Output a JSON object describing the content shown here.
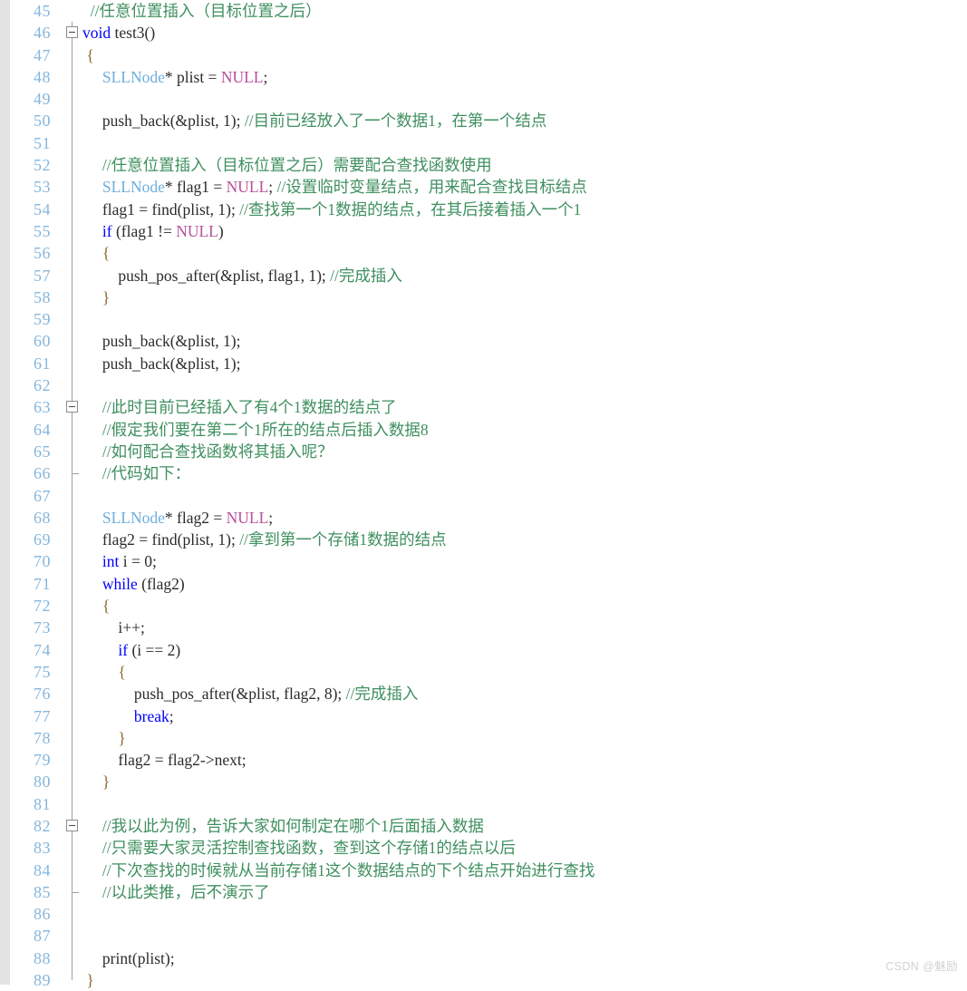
{
  "editor": {
    "language": "c",
    "first_line_number": 45,
    "colors": {
      "background": "#ffffff",
      "gutter_strip": "#e3e3e5",
      "line_number": "#85b6dd",
      "comment": "#3f8f5f",
      "keyword": "#0000ff",
      "type": "#6faedc",
      "macro": "#b7509a",
      "brace": "#8a6a2a",
      "text": "#2b2b2b",
      "fold_line": "#a0a0a0"
    }
  },
  "watermark": "CSDN @魅励",
  "lines": [
    {
      "n": "45",
      "fold": "none",
      "tokens": [
        {
          "t": "  ",
          "c": "plain"
        },
        {
          "t": "//任意位置插入（目标位置之后）",
          "c": "cmt"
        }
      ]
    },
    {
      "n": "46",
      "fold": "box",
      "tokens": [
        {
          "t": "void",
          "c": "kw"
        },
        {
          "t": " test3()",
          "c": "plain"
        }
      ]
    },
    {
      "n": "47",
      "fold": "line",
      "tokens": [
        {
          "t": " ",
          "c": "plain"
        },
        {
          "t": "{",
          "c": "brace"
        }
      ]
    },
    {
      "n": "48",
      "fold": "line",
      "tokens": [
        {
          "t": "     ",
          "c": "plain"
        },
        {
          "t": "SLLNode",
          "c": "type"
        },
        {
          "t": "* plist = ",
          "c": "plain"
        },
        {
          "t": "NULL",
          "c": "macro"
        },
        {
          "t": ";",
          "c": "plain"
        }
      ]
    },
    {
      "n": "49",
      "fold": "line",
      "tokens": []
    },
    {
      "n": "50",
      "fold": "line",
      "tokens": [
        {
          "t": "     push_back(&plist, 1); ",
          "c": "plain"
        },
        {
          "t": "//目前已经放入了一个数据1，在第一个结点",
          "c": "cmt"
        }
      ]
    },
    {
      "n": "51",
      "fold": "line",
      "tokens": []
    },
    {
      "n": "52",
      "fold": "line",
      "tokens": [
        {
          "t": "     ",
          "c": "plain"
        },
        {
          "t": "//任意位置插入（目标位置之后）需要配合查找函数使用",
          "c": "cmt"
        }
      ]
    },
    {
      "n": "53",
      "fold": "line",
      "tokens": [
        {
          "t": "     ",
          "c": "plain"
        },
        {
          "t": "SLLNode",
          "c": "type"
        },
        {
          "t": "* flag1 = ",
          "c": "plain"
        },
        {
          "t": "NULL",
          "c": "macro"
        },
        {
          "t": "; ",
          "c": "plain"
        },
        {
          "t": "//设置临时变量结点，用来配合查找目标结点",
          "c": "cmt"
        }
      ]
    },
    {
      "n": "54",
      "fold": "line",
      "tokens": [
        {
          "t": "     flag1 = find(plist, 1); ",
          "c": "plain"
        },
        {
          "t": "//查找第一个1数据的结点，在其后接着插入一个1",
          "c": "cmt"
        }
      ]
    },
    {
      "n": "55",
      "fold": "line",
      "tokens": [
        {
          "t": "     ",
          "c": "plain"
        },
        {
          "t": "if",
          "c": "kw"
        },
        {
          "t": " (flag1 != ",
          "c": "plain"
        },
        {
          "t": "NULL",
          "c": "macro"
        },
        {
          "t": ")",
          "c": "plain"
        }
      ]
    },
    {
      "n": "56",
      "fold": "line",
      "tokens": [
        {
          "t": "     ",
          "c": "plain"
        },
        {
          "t": "{",
          "c": "brace"
        }
      ]
    },
    {
      "n": "57",
      "fold": "line",
      "tokens": [
        {
          "t": "         push_pos_after(&plist, flag1, 1); ",
          "c": "plain"
        },
        {
          "t": "//完成插入",
          "c": "cmt"
        }
      ]
    },
    {
      "n": "58",
      "fold": "line",
      "tokens": [
        {
          "t": "     ",
          "c": "plain"
        },
        {
          "t": "}",
          "c": "brace"
        }
      ]
    },
    {
      "n": "59",
      "fold": "line",
      "tokens": []
    },
    {
      "n": "60",
      "fold": "line",
      "tokens": [
        {
          "t": "     push_back(&plist, 1);",
          "c": "plain"
        }
      ]
    },
    {
      "n": "61",
      "fold": "line",
      "tokens": [
        {
          "t": "     push_back(&plist, 1);",
          "c": "plain"
        }
      ]
    },
    {
      "n": "62",
      "fold": "line",
      "tokens": []
    },
    {
      "n": "63",
      "fold": "box",
      "tokens": [
        {
          "t": "     ",
          "c": "plain"
        },
        {
          "t": "//此时目前已经插入了有4个1数据的结点了",
          "c": "cmt"
        }
      ]
    },
    {
      "n": "64",
      "fold": "line",
      "tokens": [
        {
          "t": "     ",
          "c": "plain"
        },
        {
          "t": "//假定我们要在第二个1所在的结点后插入数据8",
          "c": "cmt"
        }
      ]
    },
    {
      "n": "65",
      "fold": "line",
      "tokens": [
        {
          "t": "     ",
          "c": "plain"
        },
        {
          "t": "//如何配合查找函数将其插入呢？",
          "c": "cmt"
        }
      ]
    },
    {
      "n": "66",
      "fold": "tick",
      "tokens": [
        {
          "t": "     ",
          "c": "plain"
        },
        {
          "t": "//代码如下：",
          "c": "cmt"
        }
      ]
    },
    {
      "n": "67",
      "fold": "line",
      "tokens": []
    },
    {
      "n": "68",
      "fold": "line",
      "tokens": [
        {
          "t": "     ",
          "c": "plain"
        },
        {
          "t": "SLLNode",
          "c": "type"
        },
        {
          "t": "* flag2 = ",
          "c": "plain"
        },
        {
          "t": "NULL",
          "c": "macro"
        },
        {
          "t": ";",
          "c": "plain"
        }
      ]
    },
    {
      "n": "69",
      "fold": "line",
      "tokens": [
        {
          "t": "     flag2 = find(plist, 1); ",
          "c": "plain"
        },
        {
          "t": "//拿到第一个存储1数据的结点",
          "c": "cmt"
        }
      ]
    },
    {
      "n": "70",
      "fold": "line",
      "tokens": [
        {
          "t": "     ",
          "c": "plain"
        },
        {
          "t": "int",
          "c": "kw"
        },
        {
          "t": " i = 0;",
          "c": "plain"
        }
      ]
    },
    {
      "n": "71",
      "fold": "line",
      "tokens": [
        {
          "t": "     ",
          "c": "plain"
        },
        {
          "t": "while",
          "c": "kw"
        },
        {
          "t": " (flag2)",
          "c": "plain"
        }
      ]
    },
    {
      "n": "72",
      "fold": "line",
      "tokens": [
        {
          "t": "     ",
          "c": "plain"
        },
        {
          "t": "{",
          "c": "brace"
        }
      ]
    },
    {
      "n": "73",
      "fold": "line",
      "tokens": [
        {
          "t": "         i++;",
          "c": "plain"
        }
      ]
    },
    {
      "n": "74",
      "fold": "line",
      "tokens": [
        {
          "t": "         ",
          "c": "plain"
        },
        {
          "t": "if",
          "c": "kw"
        },
        {
          "t": " (i == 2)",
          "c": "plain"
        }
      ]
    },
    {
      "n": "75",
      "fold": "line",
      "tokens": [
        {
          "t": "         ",
          "c": "plain"
        },
        {
          "t": "{",
          "c": "brace"
        }
      ]
    },
    {
      "n": "76",
      "fold": "line",
      "tokens": [
        {
          "t": "             push_pos_after(&plist, flag2, 8); ",
          "c": "plain"
        },
        {
          "t": "//完成插入",
          "c": "cmt"
        }
      ]
    },
    {
      "n": "77",
      "fold": "line",
      "tokens": [
        {
          "t": "             ",
          "c": "plain"
        },
        {
          "t": "break",
          "c": "kw"
        },
        {
          "t": ";",
          "c": "plain"
        }
      ]
    },
    {
      "n": "78",
      "fold": "line",
      "tokens": [
        {
          "t": "         ",
          "c": "plain"
        },
        {
          "t": "}",
          "c": "brace"
        }
      ]
    },
    {
      "n": "79",
      "fold": "line",
      "tokens": [
        {
          "t": "         flag2 = flag2->next;",
          "c": "plain"
        }
      ]
    },
    {
      "n": "80",
      "fold": "line",
      "tokens": [
        {
          "t": "     ",
          "c": "plain"
        },
        {
          "t": "}",
          "c": "brace"
        }
      ]
    },
    {
      "n": "81",
      "fold": "line",
      "tokens": []
    },
    {
      "n": "82",
      "fold": "box",
      "tokens": [
        {
          "t": "     ",
          "c": "plain"
        },
        {
          "t": "//我以此为例，告诉大家如何制定在哪个1后面插入数据",
          "c": "cmt"
        }
      ]
    },
    {
      "n": "83",
      "fold": "line",
      "tokens": [
        {
          "t": "     ",
          "c": "plain"
        },
        {
          "t": "//只需要大家灵活控制查找函数，查到这个存储1的结点以后",
          "c": "cmt"
        }
      ]
    },
    {
      "n": "84",
      "fold": "line",
      "tokens": [
        {
          "t": "     ",
          "c": "plain"
        },
        {
          "t": "//下次查找的时候就从当前存储1这个数据结点的下个结点开始进行查找",
          "c": "cmt"
        }
      ]
    },
    {
      "n": "85",
      "fold": "tick",
      "tokens": [
        {
          "t": "     ",
          "c": "plain"
        },
        {
          "t": "//以此类推，后不演示了",
          "c": "cmt"
        }
      ]
    },
    {
      "n": "86",
      "fold": "line",
      "tokens": []
    },
    {
      "n": "87",
      "fold": "line",
      "tokens": []
    },
    {
      "n": "88",
      "fold": "line",
      "tokens": [
        {
          "t": "     print(plist);",
          "c": "plain"
        }
      ]
    },
    {
      "n": "89",
      "fold": "half-top",
      "tokens": [
        {
          "t": " ",
          "c": "plain"
        },
        {
          "t": "}",
          "c": "brace"
        }
      ]
    }
  ]
}
